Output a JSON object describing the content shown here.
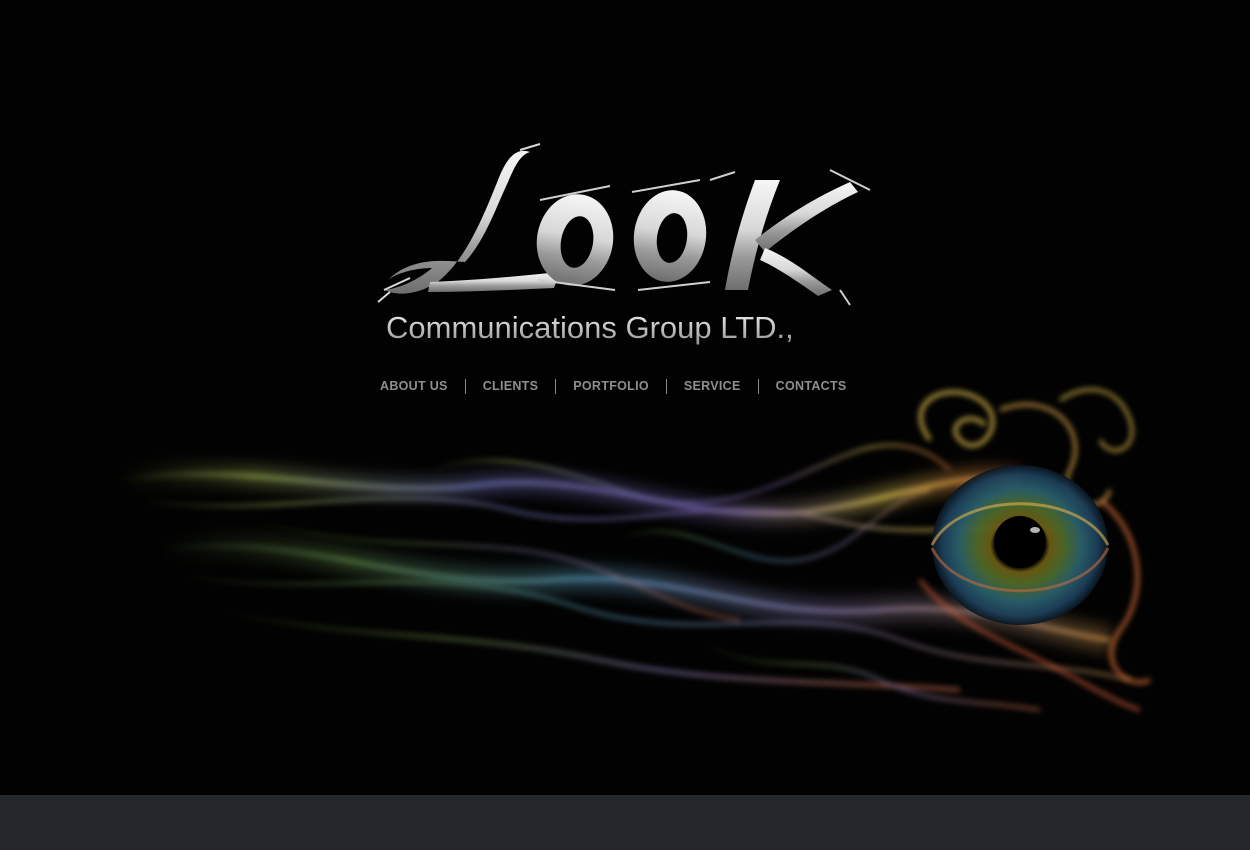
{
  "logo": {
    "word": "LOOK",
    "tagline": "Communications Group LTD.,"
  },
  "nav": {
    "items": [
      {
        "label": "ABOUT US"
      },
      {
        "label": "CLIENTS"
      },
      {
        "label": "PORTFOLIO"
      },
      {
        "label": "SERVICE"
      },
      {
        "label": "CONTACTS"
      }
    ]
  },
  "colors": {
    "background": "#020202",
    "footer": "#24272c",
    "nav_text": "#8f8f8f",
    "logo_silver": "#d0d0d0"
  },
  "icons": {
    "hero_image": "smoke-eye-image"
  }
}
